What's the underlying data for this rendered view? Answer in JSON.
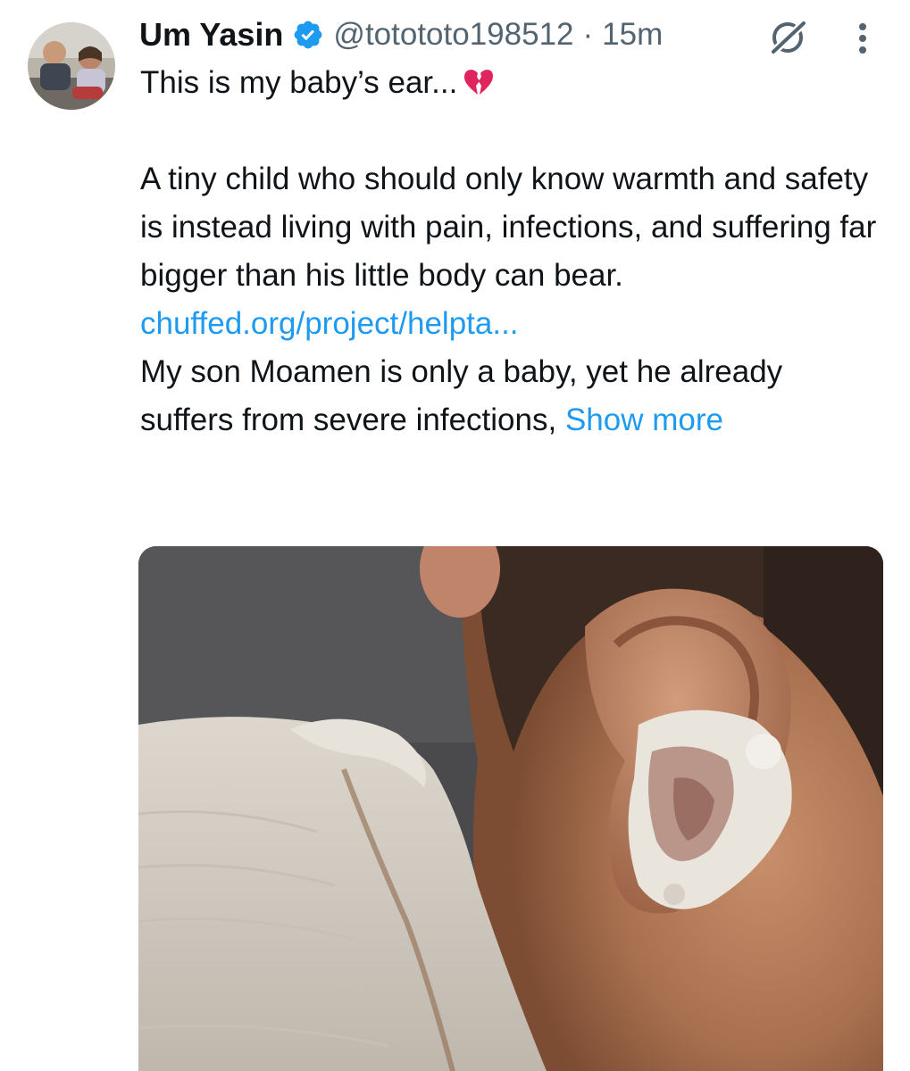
{
  "author": {
    "display_name": "Um Yasin",
    "verified": true,
    "handle": "@totototo198512",
    "separator": "·",
    "time": "15m",
    "avatar_icon": "avatar-photo-two-children"
  },
  "icons": {
    "verified": "verified-badge-icon",
    "grok": "grok-icon",
    "more": "more-vertical-icon",
    "emoji": "broken-heart-icon"
  },
  "tweet": {
    "line1": "This is my baby’s ear...",
    "paragraph2": "A tiny child who should only know warmth and safety is instead living with pain, infections, and suffering far bigger than his little body can bear.",
    "link": "chuffed.org/project/helpta...",
    "paragraph3": "My son Moamen is only a baby, yet he already suffers from severe infections,",
    "show_more": "Show more"
  },
  "media": {
    "kind": "photo-baby-ear-infection"
  },
  "colors": {
    "link": "#1d9bf0",
    "verified": "#1d9bf0",
    "heart": "#e0245e",
    "secondary_text": "#536471",
    "primary_text": "#0f1419"
  }
}
